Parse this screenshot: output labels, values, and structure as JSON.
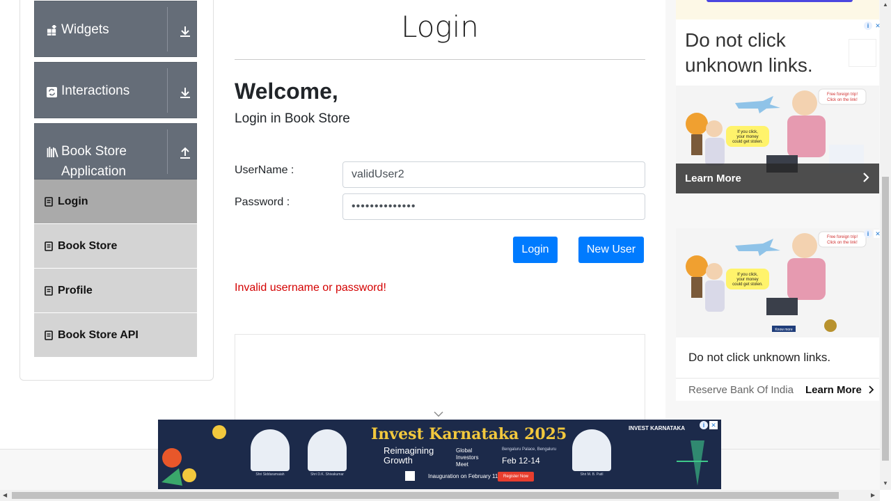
{
  "sidebar": {
    "groups": [
      {
        "label": "Widgets",
        "icon": "widgets-icon",
        "arrow": "download-arrow-icon"
      },
      {
        "label": "Interactions",
        "icon": "interactions-icon",
        "arrow": "download-arrow-icon"
      },
      {
        "label": "Book Store Application",
        "label_line1": "Book Store",
        "label_line2": "Application",
        "icon": "books-icon",
        "arrow": "upload-arrow-icon"
      }
    ],
    "items": [
      {
        "label": "Login",
        "active": true
      },
      {
        "label": "Book Store",
        "active": false
      },
      {
        "label": "Profile",
        "active": false
      },
      {
        "label": "Book Store API",
        "active": false
      }
    ]
  },
  "main": {
    "title": "Login",
    "welcome": "Welcome,",
    "subheading": "Login in Book Store",
    "username_label": "UserName :",
    "username_value": "validUser2",
    "password_label": "Password :",
    "password_value": "••••••••••••••",
    "login_button": "Login",
    "new_user_button": "New User",
    "error_message": "Invalid username or password!"
  },
  "ads": {
    "right_top": {
      "headline": "Do not click unknown links.",
      "cta": "Learn More"
    },
    "right_bottom": {
      "headline": "Do not click unknown links.",
      "advertiser": "Reserve Bank Of India",
      "cta": "Learn More"
    },
    "art_text": {
      "bubble1": "Free foreign trip! Click on the link!",
      "bubble2": "If you click, your money could get stolen.",
      "know_more": "Know more"
    },
    "banner": {
      "title": "Invest Karnataka 2025",
      "subtitle": "Reimagining Growth",
      "meet": "Global Investors Meet",
      "venue": "Bengaluru Palace, Bengaluru",
      "dates": "Feb 12-14",
      "inauguration": "Inauguration on February 11",
      "register": "Register Now",
      "logo": "INVEST KARNATAKA",
      "people": [
        "Shri Siddaramaiah",
        "Shri D.K. Shivakumar",
        "Shri M. B. Patil"
      ]
    }
  },
  "colors": {
    "sidebar_header": "#656d78",
    "menu_item": "#d4d4d4",
    "menu_active": "#aaaaaa",
    "primary": "#007bff",
    "error": "#d40000",
    "banner_bg": "#1c2a4a",
    "banner_title": "#f2c83d"
  }
}
